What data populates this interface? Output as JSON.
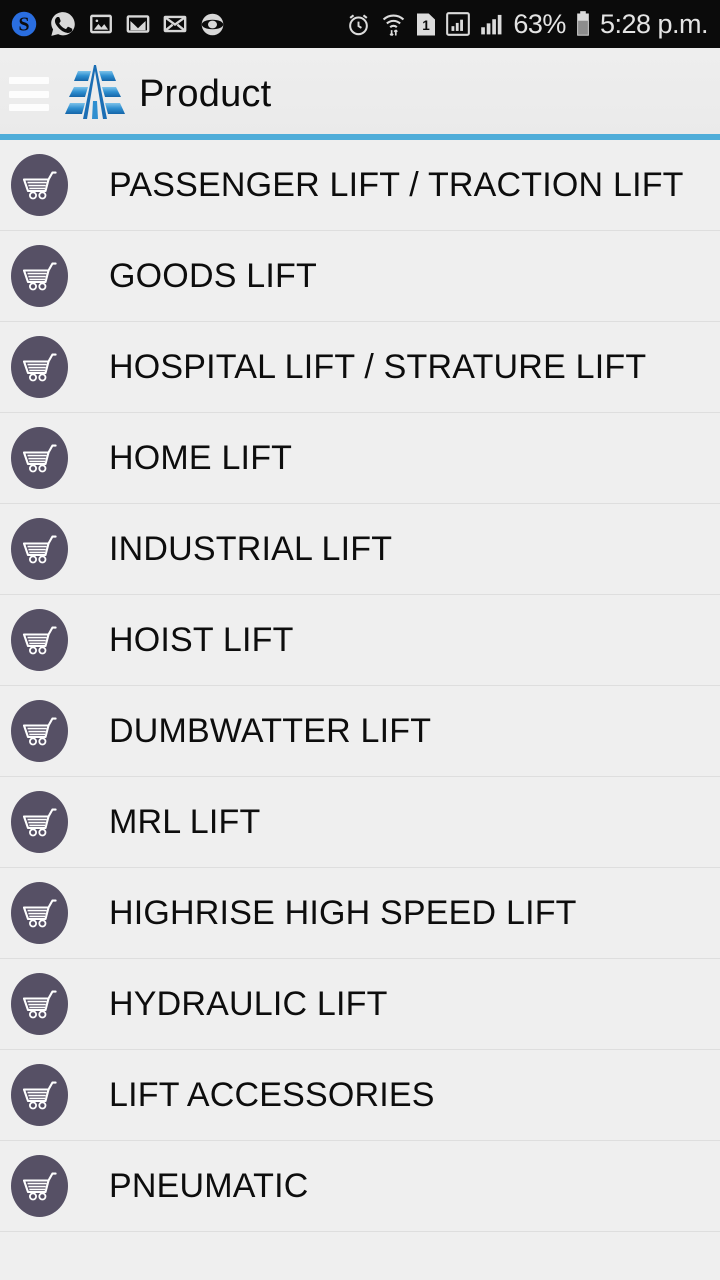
{
  "statusbar": {
    "left_icons": [
      {
        "name": "skype-s-icon",
        "glyph": "S"
      },
      {
        "name": "whatsapp-icon",
        "glyph": "whatsapp"
      },
      {
        "name": "gallery-photo-icon",
        "glyph": "photo"
      },
      {
        "name": "gmail-icon",
        "glyph": "M"
      },
      {
        "name": "email-envelope-icon",
        "glyph": "envelope"
      },
      {
        "name": "opera-circle-icon",
        "glyph": "circle"
      }
    ],
    "right_icons": [
      {
        "name": "alarm-clock-icon"
      },
      {
        "name": "wifi-icon"
      },
      {
        "name": "sim-card-1-icon",
        "glyph": "1"
      },
      {
        "name": "signal-bars-boxed-icon"
      },
      {
        "name": "signal-bars-icon"
      }
    ],
    "battery_percent": "63%",
    "battery_icon": "battery-icon",
    "clock": "5:28 p.m."
  },
  "header": {
    "menu_icon": "hamburger-menu-icon",
    "logo_icon": "app-logo-icon",
    "title": "Product",
    "accent_color": "#4fadd9",
    "background_color": "#ebebeb"
  },
  "list": {
    "icon_color": "#565065",
    "items": [
      {
        "label": "PASSENGER LIFT / TRACTION LIFT",
        "icon": "shopping-cart-icon"
      },
      {
        "label": "GOODS LIFT",
        "icon": "shopping-cart-icon"
      },
      {
        "label": "HOSPITAL LIFT / STRATURE LIFT",
        "icon": "shopping-cart-icon"
      },
      {
        "label": "HOME LIFT",
        "icon": "shopping-cart-icon"
      },
      {
        "label": "INDUSTRIAL LIFT",
        "icon": "shopping-cart-icon"
      },
      {
        "label": "HOIST LIFT",
        "icon": "shopping-cart-icon"
      },
      {
        "label": "DUMBWATTER LIFT",
        "icon": "shopping-cart-icon"
      },
      {
        "label": "MRL LIFT",
        "icon": "shopping-cart-icon"
      },
      {
        "label": "HIGHRISE HIGH SPEED LIFT",
        "icon": "shopping-cart-icon"
      },
      {
        "label": "HYDRAULIC LIFT",
        "icon": "shopping-cart-icon"
      },
      {
        "label": "LIFT ACCESSORIES",
        "icon": "shopping-cart-icon"
      },
      {
        "label": "PNEUMATIC",
        "icon": "shopping-cart-icon"
      }
    ]
  }
}
